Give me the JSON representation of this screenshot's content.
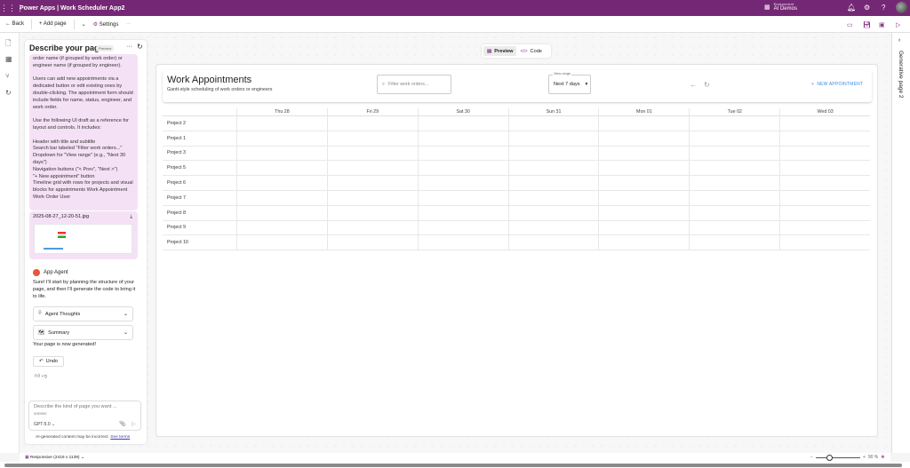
{
  "app": {
    "title": "Power Apps  |  Work Scheduler App2",
    "environment_label": "Environment",
    "environment": "AI Demos",
    "brand_color": "#742774"
  },
  "toolbar": {
    "back": "Back",
    "add_page": "Add page",
    "settings": "Settings",
    "more": "···"
  },
  "panel": {
    "title": "Describe your page",
    "badge": "Preview",
    "prompt_text": "order name (if grouped by work order) or engineer name (if grouped by engineer).\n\nUsers can add new appointments via a dedicated button or edit existing ones by double-clicking. The appointment form should include fields for name, status, engineer, and work order.\n\nUse the following UI draft as a reference for layout and controls. It includes:\n\nHeader with title and subtitle\nSearch bar labeled \"Filter work orders...\"\nDropdown for \"View range\" (e.g., \"Next 30 days\")\nNavigation buttons (\"< Prev\", \"Next >\")\n\"+ New appointment\" button\nTimeline grid with rows for projects and visual blocks for appointments Work Appointment Work Order User",
    "attachment": "2025-08-27_12-20-51.jpg",
    "agent_name": "App Agent",
    "agent_message": "Sure! I'll start by planning the structure of your page, and then I'll generate the code to bring it to life.",
    "agent_thoughts": "Agent Thoughts",
    "summary": "Summary",
    "generated": "Your page is now generated!",
    "undo": "Undo",
    "input_placeholder": "Describe the kind of page you want ...",
    "char_count": "0/50000",
    "model": "GPT-5.0",
    "disclaimer": "AI-generated content may be incorrect.",
    "see_terms": "See terms"
  },
  "view_toggle": {
    "preview": "Preview",
    "code": "Code"
  },
  "app_page": {
    "title": "Work Appointments",
    "subtitle": "Gantt-style scheduling of work orders or engineers",
    "search_placeholder": "Filter work orders...",
    "view_range_label": "View range",
    "view_range": "Next 7 days",
    "new_appointment": "NEW APPOINTMENT",
    "accent": "#3c8ee0",
    "days": [
      "Thu 28",
      "Fri 29",
      "Sat 30",
      "Sun 31",
      "Mon 01",
      "Tue 02",
      "Wed 03"
    ],
    "rows": [
      "Project 2",
      "Project 1",
      "Project 3",
      "Project 5",
      "Project 6",
      "Project 7",
      "Project 8",
      "Project 9",
      "Project 10"
    ]
  },
  "right_panel": {
    "title": "Generative page 2"
  },
  "status": {
    "responsive": "Responsive (2419 x 1139)",
    "zoom": "90 %"
  }
}
